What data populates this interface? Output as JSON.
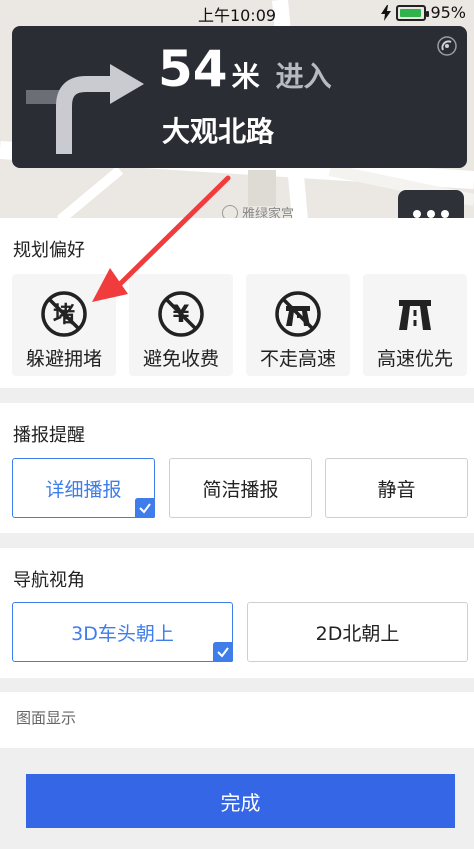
{
  "status_bar": {
    "time": "上午10:09",
    "battery_percent": 95,
    "battery_label": "95%"
  },
  "guidance": {
    "distance_value": "54",
    "distance_unit": "米",
    "action": "进入",
    "road_name": "大观北路",
    "turn_icon": "turn-right-arrow-icon"
  },
  "map": {
    "poi_label": "雅绿家宫"
  },
  "route_preference": {
    "title": "规划偏好",
    "options": [
      {
        "label": "躲避拥堵",
        "icon": "avoid-congestion-icon",
        "icon_char": "堵"
      },
      {
        "label": "避免收费",
        "icon": "avoid-toll-icon",
        "icon_char": "¥"
      },
      {
        "label": "不走高速",
        "icon": "no-highway-icon",
        "icon_char": ""
      },
      {
        "label": "高速优先",
        "icon": "highway-first-icon",
        "icon_char": ""
      }
    ]
  },
  "broadcast": {
    "title": "播报提醒",
    "options": [
      {
        "label": "详细播报",
        "selected": true
      },
      {
        "label": "简洁播报",
        "selected": false
      },
      {
        "label": "静音",
        "selected": false
      }
    ]
  },
  "nav_view": {
    "title": "导航视角",
    "options": [
      {
        "label": "3D车头朝上",
        "selected": true
      },
      {
        "label": "2D北朝上",
        "selected": false
      }
    ]
  },
  "map_display": {
    "title": "图面显示"
  },
  "done_button": {
    "label": "完成"
  },
  "colors": {
    "accent": "#3f7dea",
    "done": "#3566e6",
    "guide_bg": "#2a2d33",
    "annotation_arrow": "#f03c3c"
  }
}
